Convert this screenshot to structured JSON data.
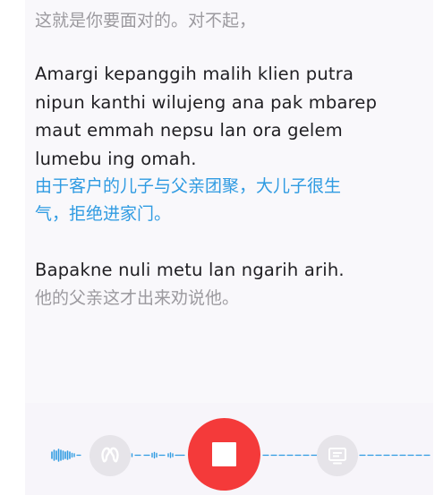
{
  "transcript": {
    "previous_translation": "这就是你要面对的。对不起，",
    "segments": [
      {
        "source": "Amargi kepanggih malih klien putra nipun kanthi wilujeng ana pak mbarep maut emmah nepsu lan ora gelem lumebu ing omah.",
        "source_lines": [
          "Amargi kepanggih malih klien putra",
          "nipun kanthi wilujeng ana pak mbarep",
          "maut emmah nepsu lan ora gelem",
          "lumebu ing omah."
        ],
        "translation_lines": [
          "由于客户的儿子与父亲团聚，大儿子很生",
          "气，拒绝进家门。"
        ]
      },
      {
        "source_lines": [
          "Bapakne nuli metu lan ngarih arih."
        ],
        "translation_lines": [
          "他的父亲这才出来劝说他。"
        ]
      }
    ]
  },
  "controls": {
    "left_button_icon": "ear-listen-icon",
    "stop_button_icon": "stop-icon",
    "right_button_icon": "subtitle-screen-icon",
    "recording_state": "recording"
  },
  "colors": {
    "source_text": "#1f1e22",
    "translation_text": "#2f9be2",
    "faded_text": "#9c9a9f",
    "stop_button": "#f43a3a",
    "waveform": "#2f9be2"
  }
}
